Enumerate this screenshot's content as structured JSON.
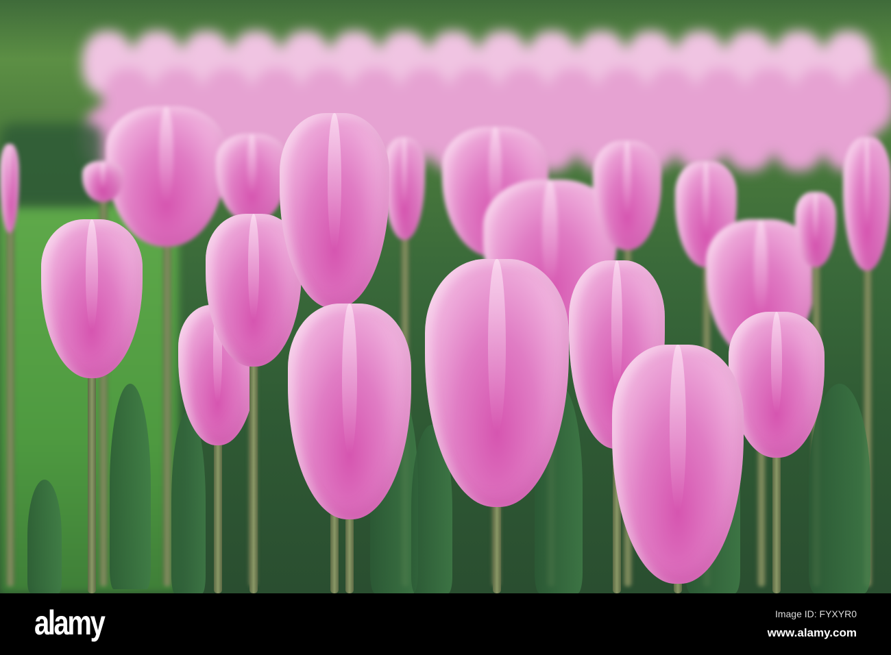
{
  "photo": {
    "subject": "pink tulips",
    "colors": {
      "petal": "#e07cc4",
      "petal_light": "#f8dcef",
      "stem": "#8a9866",
      "grass": "#5fa94a"
    }
  },
  "watermark": {
    "text": "alamy"
  },
  "footer": {
    "logo": "alamy",
    "image_id": "Image ID: FYXYR0",
    "website": "www.alamy.com"
  }
}
